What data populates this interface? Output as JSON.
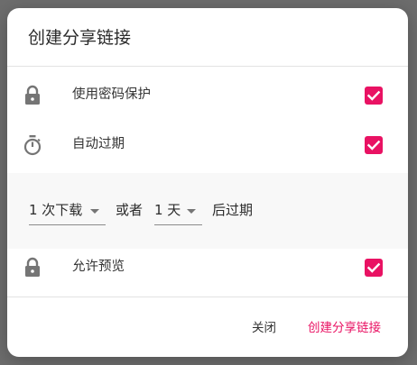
{
  "dialog": {
    "title": "创建分享链接"
  },
  "options": [
    {
      "label": "使用密码保护",
      "icon": "lock-icon",
      "checked": true
    },
    {
      "label": "自动过期",
      "icon": "timer-icon",
      "checked": true
    },
    {
      "label": "允许预览",
      "icon": "lock-icon",
      "checked": true
    }
  ],
  "expiry": {
    "downloads_value": "1 次下载",
    "or_label": "或者",
    "days_value": "1 天",
    "suffix_label": "后过期"
  },
  "actions": {
    "close_label": "关闭",
    "create_label": "创建分享链接"
  },
  "colors": {
    "accent": "#e91263",
    "checkbox": "#e91263",
    "icon": "#757575",
    "backdrop": "#6d6d6d"
  }
}
